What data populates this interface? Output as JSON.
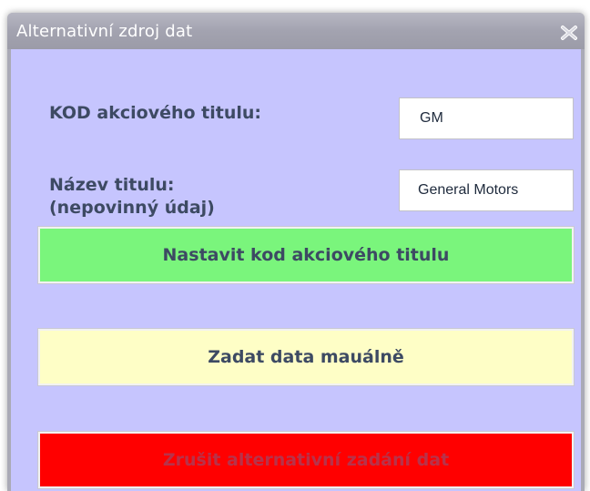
{
  "window": {
    "title": "Alternativní zdroj dat"
  },
  "form": {
    "code_label": "KOD akciového titulu:",
    "code_value": "GM",
    "name_label_line1": "Název titulu:",
    "name_label_line2": "(nepovinný údaj)",
    "name_value": "General Motors"
  },
  "buttons": {
    "set_code": "Nastavit kod akciového titulu",
    "manual": "Zadat data mauálně",
    "cancel": "Zrušit alternativní zadání dat"
  },
  "colors": {
    "client_bg": "#c6c5fe",
    "set_code_bg": "#7af57c",
    "manual_bg": "#fefec6",
    "cancel_bg": "#ff0000"
  },
  "icons": {
    "close": "close-icon"
  }
}
